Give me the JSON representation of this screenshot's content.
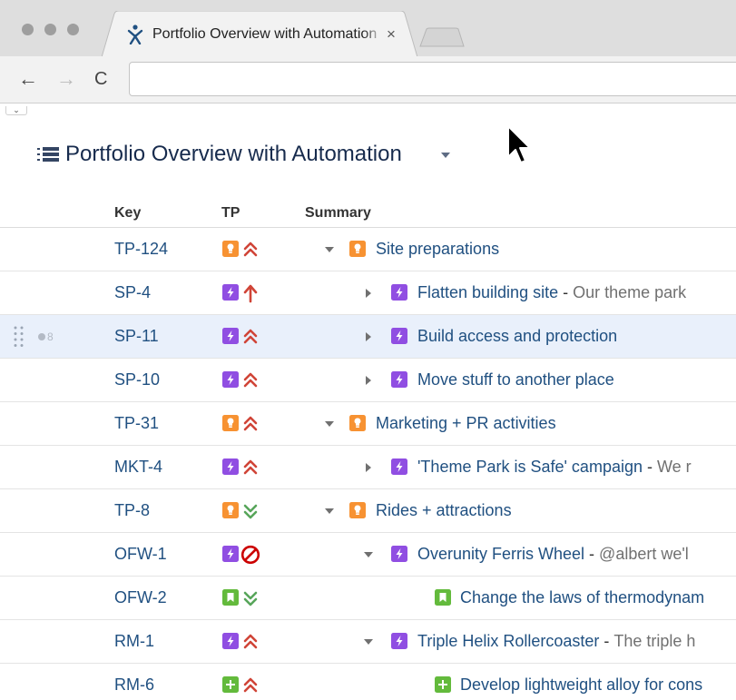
{
  "browser": {
    "tab_title": "Portfolio Overview with Automation",
    "tab_close": "×",
    "back_glyph": "←",
    "forward_glyph": "→",
    "reload_glyph": "C",
    "devtools_toggle": "⌄"
  },
  "plan": {
    "title": "Portfolio Overview with Automation"
  },
  "columns": {
    "key": "Key",
    "tp": "TP",
    "summary": "Summary"
  },
  "colors": {
    "link": "#205081",
    "initiative": "#f79232",
    "epic": "#904ee2",
    "story": "#63ba3c",
    "blocker": "#d04437",
    "trivial": "#57a55a",
    "selected_row": "#e9f0fb"
  },
  "rows": [
    {
      "key": "TP-124",
      "tp_type": "initiative",
      "priority": "major",
      "level": 0,
      "twisty": "expanded",
      "type": "initiative",
      "title": "Site preparations",
      "sep": "",
      "desc": ""
    },
    {
      "key": "SP-4",
      "tp_type": "epic",
      "priority": "highest",
      "level": 1,
      "twisty": "collapsed",
      "type": "epic",
      "title": "Flatten building site",
      "sep": " - ",
      "desc": "Our theme park"
    },
    {
      "key": "SP-11",
      "tp_type": "epic",
      "priority": "major",
      "level": 1,
      "twisty": "collapsed",
      "type": "epic",
      "title": "Build access and protection",
      "sep": "",
      "desc": "",
      "selected": true,
      "count": "8"
    },
    {
      "key": "SP-10",
      "tp_type": "epic",
      "priority": "major",
      "level": 1,
      "twisty": "collapsed",
      "type": "epic",
      "title": "Move stuff to another place",
      "sep": "",
      "desc": ""
    },
    {
      "key": "TP-31",
      "tp_type": "initiative",
      "priority": "major",
      "level": 0,
      "twisty": "expanded",
      "type": "initiative",
      "title": "Marketing + PR activities",
      "sep": "",
      "desc": ""
    },
    {
      "key": "MKT-4",
      "tp_type": "epic",
      "priority": "major",
      "level": 1,
      "twisty": "collapsed",
      "type": "epic",
      "title": "'Theme Park is Safe' campaign",
      "sep": " - ",
      "desc": "We r"
    },
    {
      "key": "TP-8",
      "tp_type": "initiative",
      "priority": "low",
      "level": 0,
      "twisty": "expanded",
      "type": "initiative",
      "title": "Rides + attractions",
      "sep": "",
      "desc": ""
    },
    {
      "key": "OFW-1",
      "tp_type": "epic",
      "priority": "blocker",
      "level": 1,
      "twisty": "expanded",
      "type": "epic",
      "title": "Overunity Ferris Wheel",
      "sep": " - ",
      "desc": "@albert we'l"
    },
    {
      "key": "OFW-2",
      "tp_type": "story",
      "priority": "low",
      "level": 2,
      "twisty": "none",
      "type": "story",
      "title": "Change the laws of thermodynam",
      "sep": "",
      "desc": ""
    },
    {
      "key": "RM-1",
      "tp_type": "epic",
      "priority": "major",
      "level": 1,
      "twisty": "expanded",
      "type": "epic",
      "title": "Triple Helix Rollercoaster",
      "sep": " - ",
      "desc": "The triple h"
    },
    {
      "key": "RM-6",
      "tp_type": "new-feature",
      "priority": "major",
      "level": 2,
      "twisty": "none",
      "type": "new-feature",
      "title": "Develop lightweight alloy for cons",
      "sep": "",
      "desc": ""
    }
  ]
}
